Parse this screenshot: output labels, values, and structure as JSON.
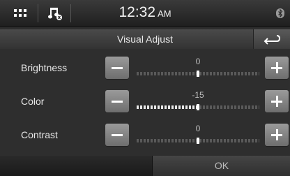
{
  "status_bar": {
    "time": "12:32",
    "ampm": "AM",
    "icons": [
      "grid-menu-icon",
      "music-source-icon",
      "bluetooth-icon"
    ]
  },
  "title_bar": {
    "title": "Visual Adjust",
    "back_icon": "back-arrow-icon"
  },
  "settings": [
    {
      "label": "Brightness",
      "value": "0",
      "level_fraction": 0.5
    },
    {
      "label": "Color",
      "value": "-15",
      "level_fraction": 0.5
    },
    {
      "label": "Contrast",
      "value": "0",
      "level_fraction": 0.5
    }
  ],
  "footer": {
    "ok_label": "OK"
  }
}
